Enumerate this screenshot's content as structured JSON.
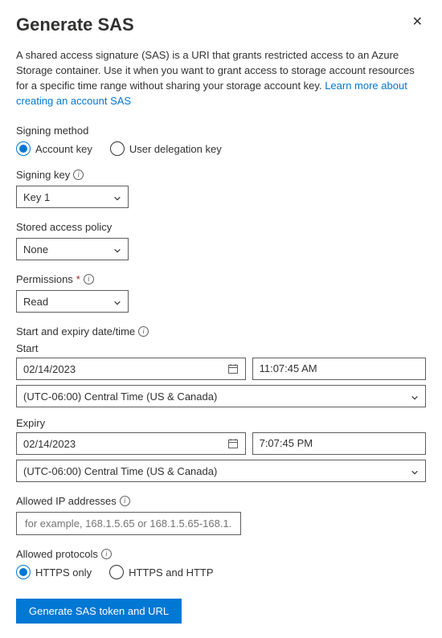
{
  "title": "Generate SAS",
  "description": {
    "text": "A shared access signature (SAS) is a URI that grants restricted access to an Azure Storage container. Use it when you want to grant access to storage account resources for a specific time range without sharing your storage account key. ",
    "link_text": "Learn more about creating an account SAS"
  },
  "signing_method": {
    "label": "Signing method",
    "options": [
      "Account key",
      "User delegation key"
    ],
    "selected": "Account key"
  },
  "signing_key": {
    "label": "Signing key",
    "value": "Key 1"
  },
  "stored_access_policy": {
    "label": "Stored access policy",
    "value": "None"
  },
  "permissions": {
    "label": "Permissions",
    "value": "Read"
  },
  "date_section": {
    "label": "Start and expiry date/time",
    "start": {
      "label": "Start",
      "date": "02/14/2023",
      "time": "11:07:45 AM",
      "tz": "(UTC-06:00) Central Time (US & Canada)"
    },
    "expiry": {
      "label": "Expiry",
      "date": "02/14/2023",
      "time": "7:07:45 PM",
      "tz": "(UTC-06:00) Central Time (US & Canada)"
    }
  },
  "allowed_ip": {
    "label": "Allowed IP addresses",
    "placeholder": "for example, 168.1.5.65 or 168.1.5.65-168.1...."
  },
  "allowed_protocols": {
    "label": "Allowed protocols",
    "options": [
      "HTTPS only",
      "HTTPS and HTTP"
    ],
    "selected": "HTTPS only"
  },
  "submit_label": "Generate SAS token and URL"
}
